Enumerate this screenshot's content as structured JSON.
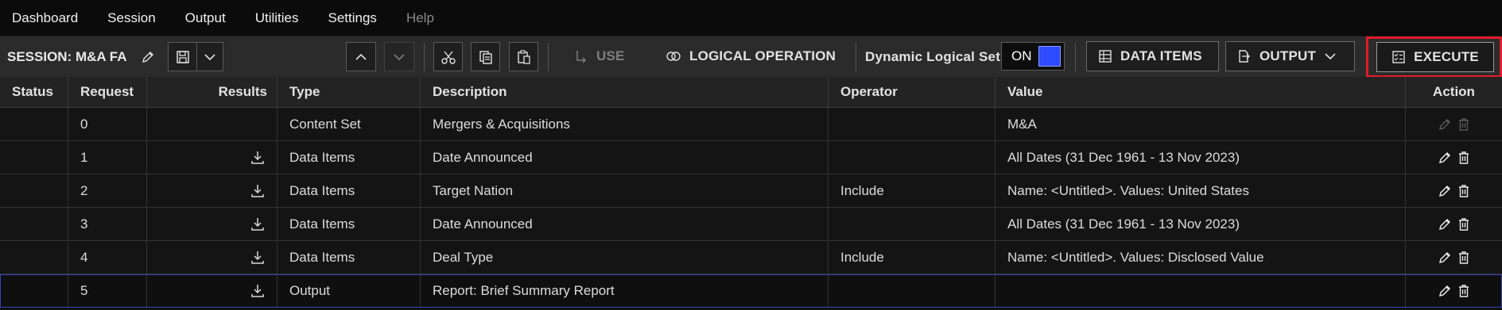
{
  "menu": {
    "items": [
      "Dashboard",
      "Session",
      "Output",
      "Utilities",
      "Settings",
      "Help"
    ]
  },
  "toolbar": {
    "session_label": "SESSION: M&A FA",
    "use_label": "USE",
    "logical_operation_label": "LOGICAL OPERATION",
    "dynamic_logical_set_label": "Dynamic Logical Set",
    "toggle_state": "ON",
    "data_items_label": "DATA ITEMS",
    "output_label": "OUTPUT",
    "execute_label": "EXECUTE"
  },
  "table": {
    "headers": {
      "status": "Status",
      "request": "Request",
      "results": "Results",
      "type": "Type",
      "description": "Description",
      "operator": "Operator",
      "value": "Value",
      "action": "Action"
    },
    "rows": [
      {
        "request": "0",
        "type": "Content Set",
        "description": "Mergers & Acquisitions",
        "operator": "",
        "value": "M&A"
      },
      {
        "request": "1",
        "type": "Data Items",
        "description": "Date Announced",
        "operator": "",
        "value": "All Dates (31 Dec 1961 - 13 Nov 2023)"
      },
      {
        "request": "2",
        "type": "Data Items",
        "description": "Target Nation",
        "operator": "Include",
        "value": "Name: <Untitled>. Values: United States"
      },
      {
        "request": "3",
        "type": "Data Items",
        "description": "Date Announced",
        "operator": "",
        "value": "All Dates (31 Dec 1961 - 13 Nov 2023)"
      },
      {
        "request": "4",
        "type": "Data Items",
        "description": "Deal Type",
        "operator": "Include",
        "value": "Name: <Untitled>. Values: Disclosed Value"
      },
      {
        "request": "5",
        "type": "Output",
        "description": "Report: Brief Summary Report",
        "operator": "",
        "value": ""
      }
    ]
  },
  "colors": {
    "accent_toggle": "#2f4bff",
    "highlight_border": "#e01b2a",
    "selected_row_border": "#3843b8"
  }
}
